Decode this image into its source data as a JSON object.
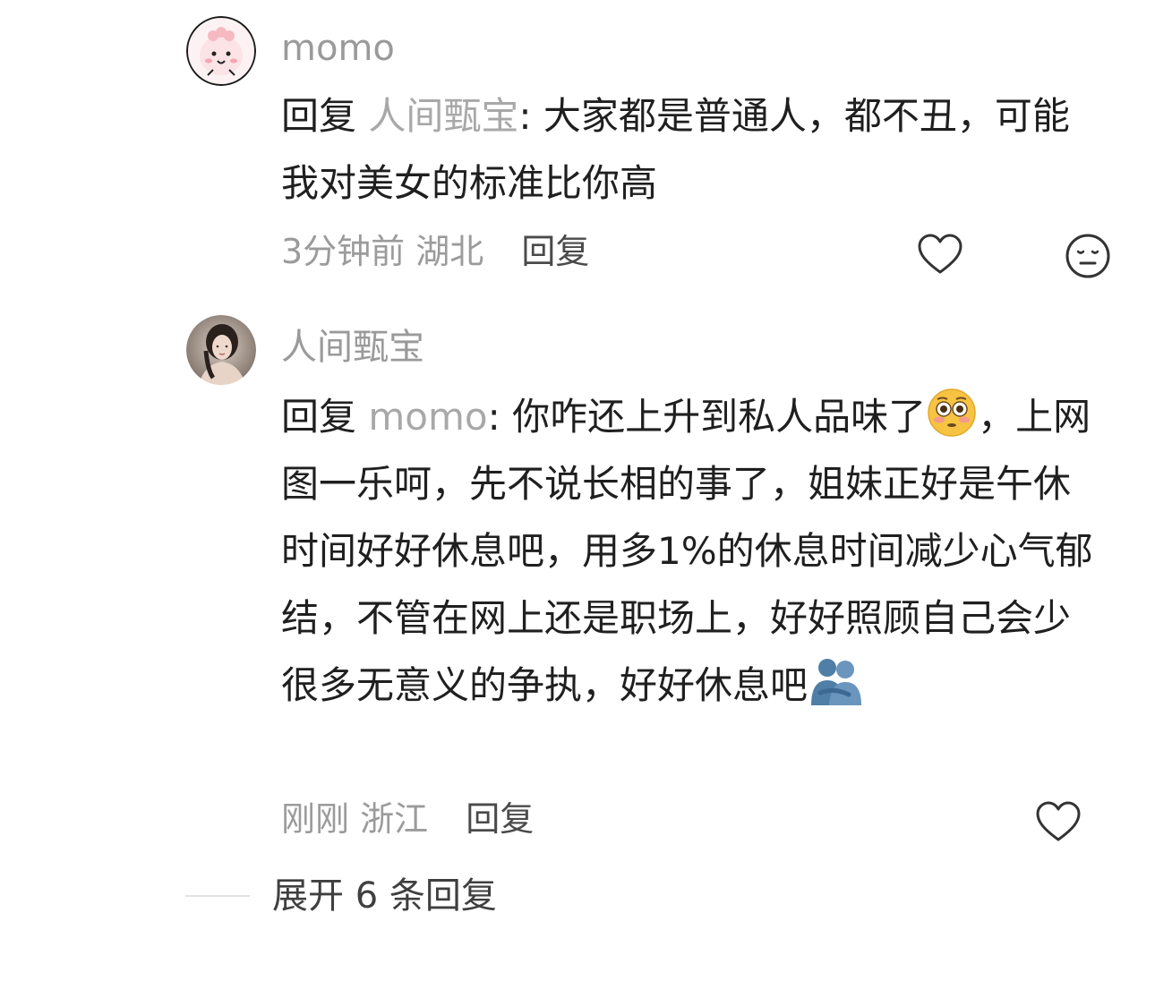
{
  "comments": [
    {
      "username": "momo",
      "avatar_icon": "pink-cartoon-avatar",
      "reply_prefix": "回复",
      "reply_target": "人间甄宝",
      "text": ": 大家都是普通人，都不丑，可能我对美女的标准比你高",
      "time": "3分钟前",
      "location": "湖北",
      "reply_label": "回复",
      "like_icon": "heart-icon",
      "dislike_icon": "meh-face-icon"
    },
    {
      "username": "人间甄宝",
      "avatar_icon": "portrait-photo-avatar",
      "reply_prefix": "回复",
      "reply_target": "momo",
      "text_part1": ": 你咋还上升到私人品味了",
      "text_part2": "，上网图一乐呵，先不说长相的事了，姐妹正好是午休时间好好休息吧，用多1%的休息时间减少心气郁结，不管在网上还是职场上，好好照顾自己会少很多无意义的争执，好好休息吧",
      "emoji_1": "flushed-face-emoji",
      "emoji_2": "hugging-people-emoji",
      "time": "刚刚",
      "location": "浙江",
      "reply_label": "回复",
      "like_icon": "heart-icon"
    }
  ],
  "expand": {
    "label": "展开 6 条回复"
  }
}
